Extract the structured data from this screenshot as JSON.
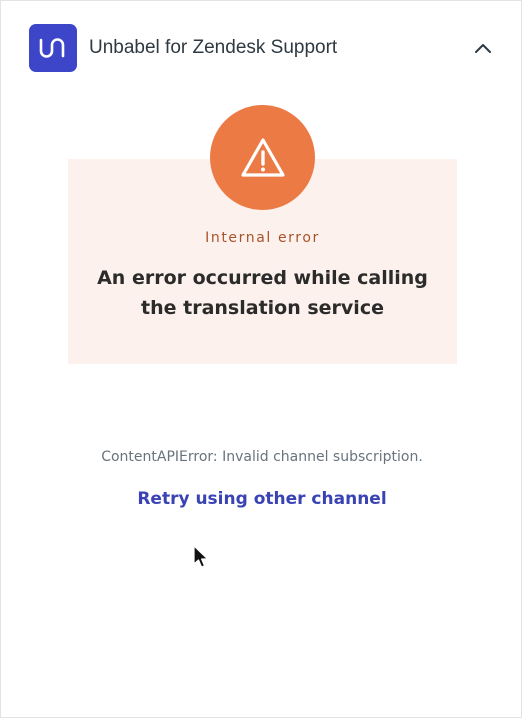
{
  "header": {
    "app_title": "Unbabel for Zendesk Support",
    "logo_icon": "unbabel-logo-icon",
    "collapse_icon": "chevron-up-icon"
  },
  "error": {
    "icon": "warning-icon",
    "type_label": "Internal error",
    "message_line1": "An error occurred while calling",
    "message_line2": "the translation service",
    "detail": "ContentAPIError: Invalid channel subscription.",
    "retry_label": "Retry using other channel"
  },
  "colors": {
    "brand": "#3d45c9",
    "warning": "#ec7a45",
    "card_background": "#fcf1ec",
    "link": "#3a43b4"
  }
}
